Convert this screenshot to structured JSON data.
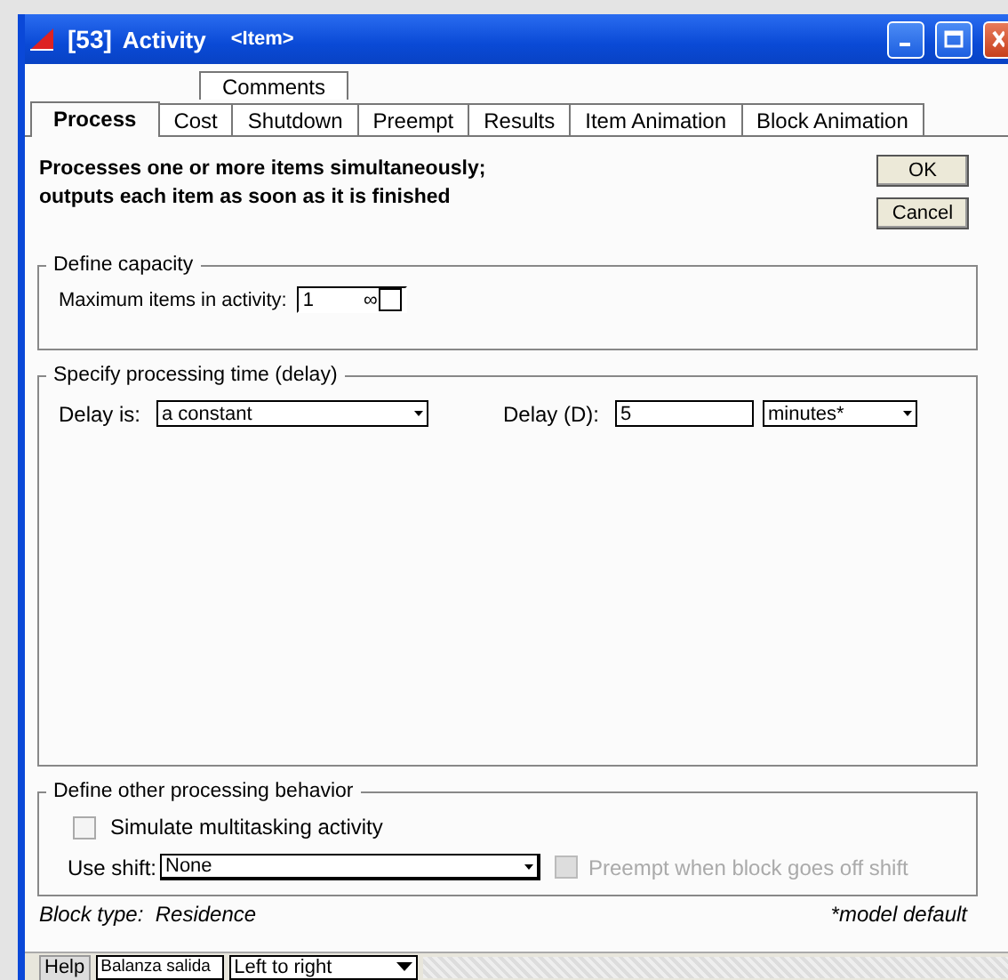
{
  "window": {
    "title_id": "[53]",
    "title": "Activity",
    "title_item": "<Item>"
  },
  "tabs_back": [
    {
      "label": "Comments",
      "selected": false
    }
  ],
  "tabs": [
    {
      "label": "Process",
      "selected": true
    },
    {
      "label": "Cost",
      "selected": false
    },
    {
      "label": "Shutdown",
      "selected": false
    },
    {
      "label": "Preempt",
      "selected": false
    },
    {
      "label": "Results",
      "selected": false
    },
    {
      "label": "Item Animation",
      "selected": false
    },
    {
      "label": "Block Animation",
      "selected": false
    }
  ],
  "description": [
    "Processes one or more items simultaneously;",
    "outputs each item as soon as it is finished"
  ],
  "buttons": [
    "OK",
    "Cancel"
  ],
  "capacity": {
    "title": "Define capacity",
    "label": "Maximum items in activity:",
    "value": "1",
    "infinity_symbol": "∞",
    "infinity_checked": false
  },
  "delay": {
    "title": "Specify processing time (delay)",
    "type_label": "Delay is:",
    "type_value": "a constant",
    "delay_label": "Delay (D):",
    "delay_value": "5",
    "units": "minutes*"
  },
  "other": {
    "title": "Define other processing behavior",
    "multitasking": {
      "label": "Simulate multitasking activity",
      "checked": false
    },
    "shift_label": "Use shift:",
    "shift_value": "None",
    "preempt": {
      "label": "Preempt when block goes off shift",
      "checked": false,
      "disabled": true
    }
  },
  "footer": {
    "block_type_label": "Block type:",
    "block_type": "Residence",
    "note": "*model default"
  },
  "bottom_bar": {
    "help": "Help",
    "name": "Balanza salida",
    "direction": "Left to right"
  }
}
